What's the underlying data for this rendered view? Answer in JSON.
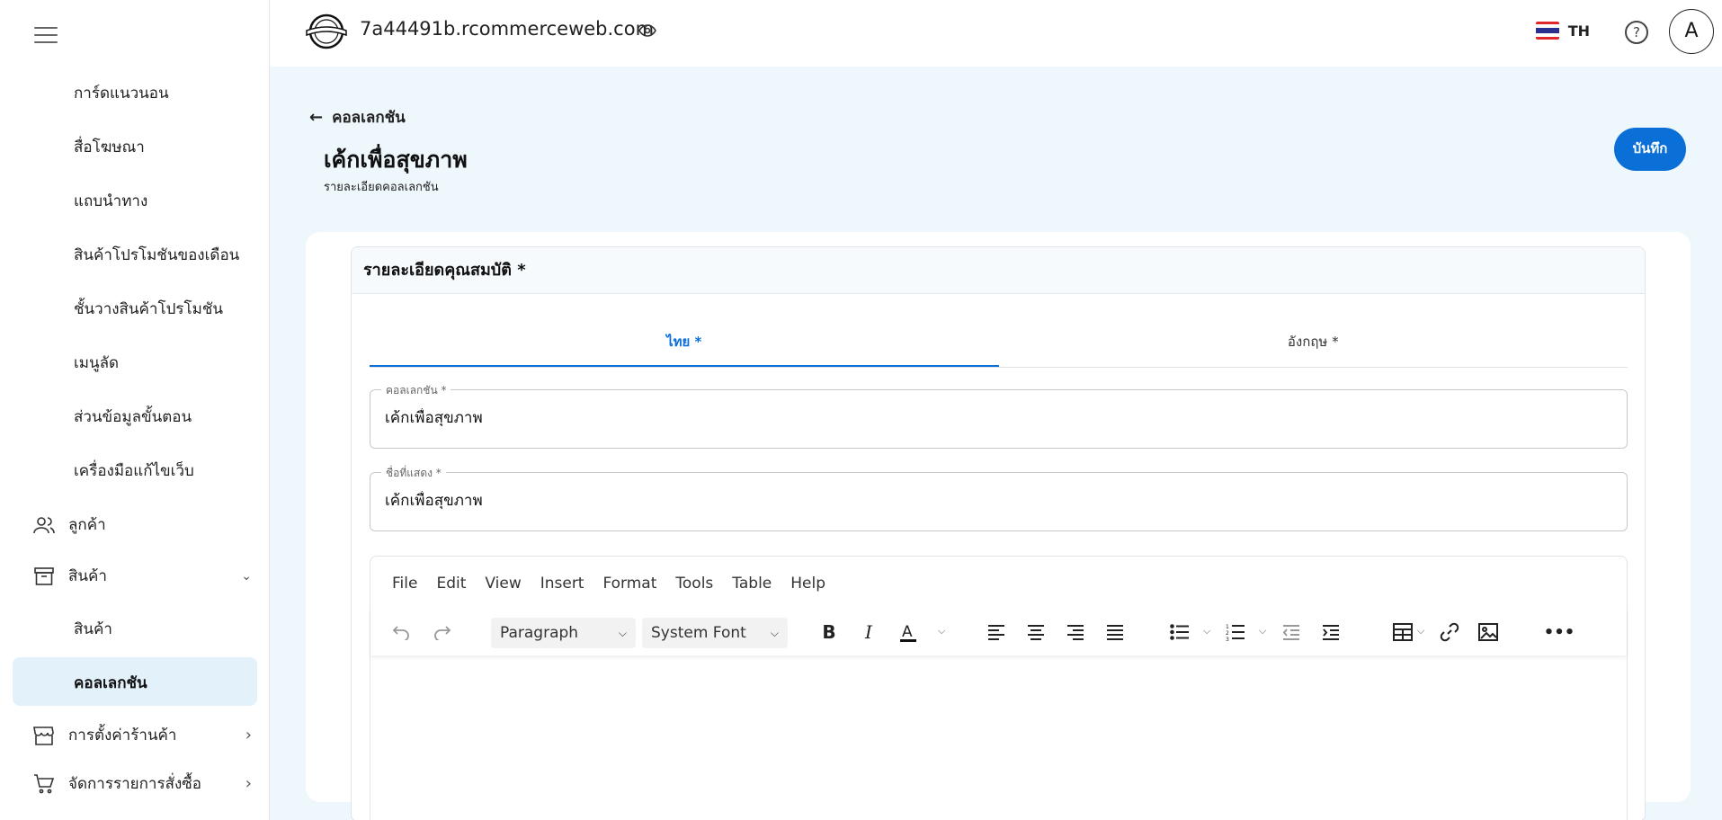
{
  "sidebar": {
    "sub_items_top": [
      "การ์ดแนวนอน",
      "สื่อโฆษณา",
      "แถบนำทาง",
      "สินค้าโปรโมชันของเดือน",
      "ชั้นวางสินค้าโปรโมชัน",
      "เมนูลัด",
      "ส่วนข้อมูลขั้นตอน",
      "เครื่องมือแก้ไขเว็บ"
    ],
    "customers": "ลูกค้า",
    "products": "สินค้า",
    "products_sub": "สินค้า",
    "collections_active": "คอลเลกชัน",
    "store_settings": "การตั้งค่าร้านค้า",
    "orders": "จัดการรายการสั่งซื้อ"
  },
  "header": {
    "domain": "7a44491b.rcommerceweb.com",
    "lang": "TH",
    "help": "?",
    "avatar": "A",
    "flag_colors": [
      "#e0262d",
      "#ffffff",
      "#2b2f8f",
      "#ffffff",
      "#e0262d"
    ]
  },
  "page": {
    "back_label": "คอลเลกชัน",
    "title": "เค้กเพื่อสุขภาพ",
    "subtitle": "รายละเอียดคอลเลกชัน",
    "save_label": "บันทึก"
  },
  "panel": {
    "title": "รายละเอียดคุณสมบัติ *",
    "tabs": [
      "ไทย *",
      "อังกฤษ *"
    ],
    "fields": [
      {
        "label": "คอลเลกชัน *",
        "value": "เค้กเพื่อสุขภาพ"
      },
      {
        "label": "ชื่อที่แสดง *",
        "value": "เค้กเพื่อสุขภาพ"
      }
    ]
  },
  "editor": {
    "menu": [
      "File",
      "Edit",
      "View",
      "Insert",
      "Format",
      "Tools",
      "Table",
      "Help"
    ],
    "block_format": "Paragraph",
    "font_family": "System Font"
  },
  "colors": {
    "accent": "#0b6fd8",
    "active_nav_bg": "#e3f1fb",
    "page_bg": "#eef7fc"
  }
}
